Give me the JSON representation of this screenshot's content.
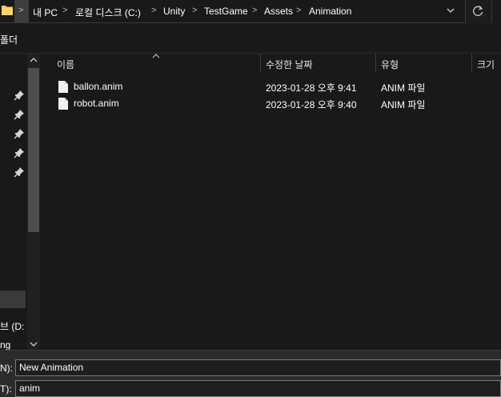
{
  "breadcrumb": {
    "items": [
      "내 PC",
      "로컬 디스크 (C:)",
      "Unity",
      "TestGame",
      "Assets",
      "Animation"
    ],
    "separator": ">"
  },
  "toolbar": {
    "new_folder_label": "폴더"
  },
  "icons": {
    "folder": "folder-icon",
    "refresh": "refresh-icon",
    "dropdown": "chevron-down-icon",
    "pin": "pin-icon",
    "file": "file-icon",
    "sort": "sort-up-icon"
  },
  "nav": {
    "pinned_count": 5,
    "drive_label": "브 (D:",
    "last_label": "ng"
  },
  "columns": {
    "name": "이름",
    "date": "수정한 날짜",
    "type": "유형",
    "size": "크기"
  },
  "files": [
    {
      "name": "ballon.anim",
      "date": "2023-01-28 오후 9:41",
      "type": "ANIM 파일"
    },
    {
      "name": "robot.anim",
      "date": "2023-01-28 오후 9:40",
      "type": "ANIM 파일"
    }
  ],
  "save_dialog": {
    "filename_label": "N):",
    "filename_value": "New Animation",
    "filetype_label": "T):",
    "filetype_value": "anim"
  },
  "colors": {
    "background": "#191919",
    "panel": "#2b2b2b",
    "folder_yellow": "#f7c948"
  }
}
